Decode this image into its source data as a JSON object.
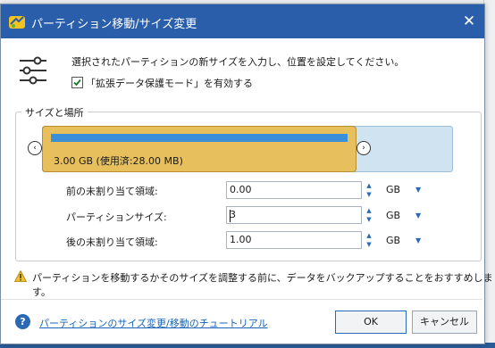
{
  "window": {
    "title": "パーティション移動/サイズ変更"
  },
  "instructions": {
    "text": "選択されたパーティションの新サイズを入力し、位置を設定してください。",
    "checkbox_label": "「拡張データ保護モード」を有効する",
    "checkbox_checked": true
  },
  "group": {
    "title": "サイズと場所",
    "partition_label": "3.00 GB (使用済:28.00 MB)"
  },
  "fields": {
    "before_label": "前の未割り当て領域:",
    "before_value": "0.00",
    "size_label": "パーティションサイズ:",
    "size_value": "3",
    "after_label": "後の未割り当て領域:",
    "after_value": "1.00",
    "unit": "GB"
  },
  "warning": {
    "text": "パーティションを移動するかそのサイズを調整する前に、データをバックアップすることをおすすめします。"
  },
  "footer": {
    "help_link": "パーティションのサイズ変更/移動のチュートリアル",
    "ok_label": "OK",
    "cancel_label": "キャンセル"
  },
  "colors": {
    "titlebar": "#2a5eab",
    "partition": "#e7bf5c",
    "used_bar": "#3a8fd8",
    "disk_free": "#cfe3f1"
  },
  "icons": {
    "app": "app-icon",
    "close": "close-icon",
    "sliders": "sliders-icon",
    "warning": "warning-icon",
    "help": "help-icon"
  }
}
